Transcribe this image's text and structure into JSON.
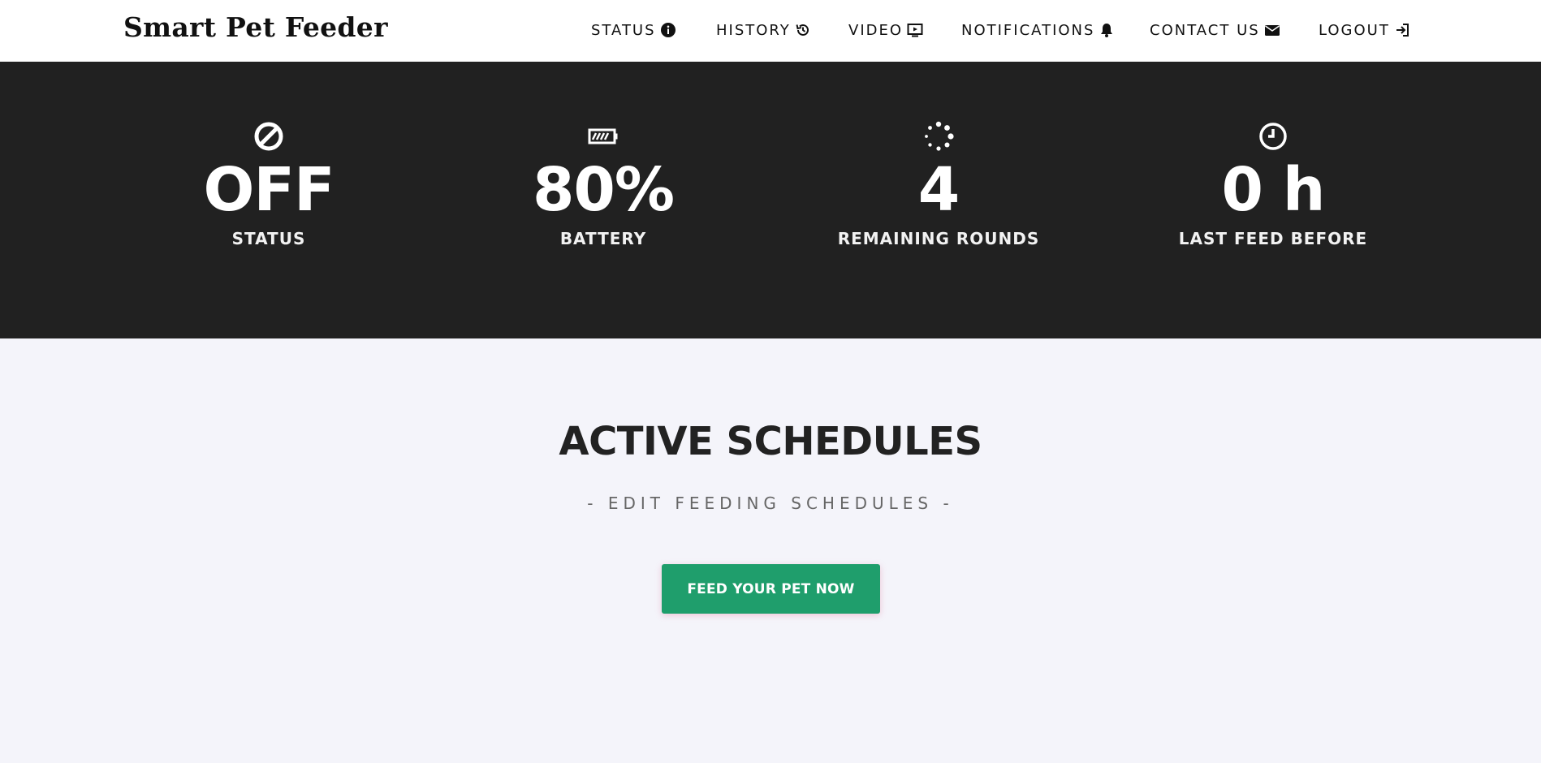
{
  "app": {
    "title": "Smart Pet Feeder"
  },
  "nav": {
    "items": [
      {
        "label": "STATUS",
        "icon": "info-circle-icon"
      },
      {
        "label": "HISTORY",
        "icon": "history-icon"
      },
      {
        "label": "VIDEO",
        "icon": "video-play-icon"
      },
      {
        "label": "NOTIFICATIONS",
        "icon": "bell-icon"
      },
      {
        "label": "CONTACT US",
        "icon": "envelope-icon"
      },
      {
        "label": "LOGOUT",
        "icon": "logout-icon"
      }
    ]
  },
  "stats": [
    {
      "value": "OFF",
      "label": "STATUS",
      "icon": "ban-icon"
    },
    {
      "value": "80%",
      "label": "BATTERY",
      "icon": "battery-icon"
    },
    {
      "value": "4",
      "label": "REMAINING ROUNDS",
      "icon": "spinner-icon"
    },
    {
      "value": "0 h",
      "label": "LAST FEED BEFORE",
      "icon": "clock-icon"
    }
  ],
  "schedules": {
    "title": "ACTIVE SCHEDULES",
    "subtitle": "- EDIT FEEDING SCHEDULES -",
    "feed_button_label": "FEED YOUR PET NOW"
  },
  "colors": {
    "header_bg": "#ffffff",
    "stats_bg": "#212121",
    "page_bg": "#f4f4fa",
    "accent_green": "#1f9e6c"
  }
}
